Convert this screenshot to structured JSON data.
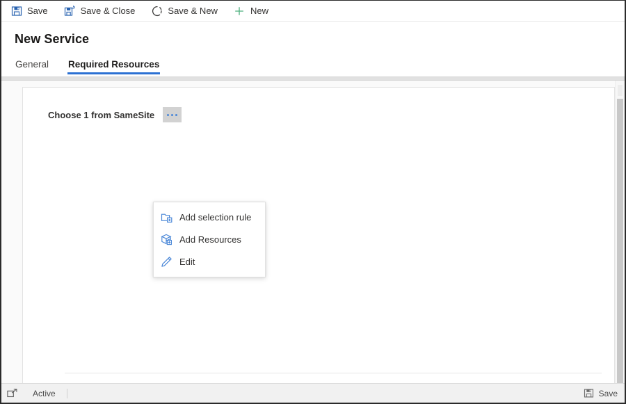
{
  "window": {
    "title": "New Service"
  },
  "commandbar": {
    "buttons": [
      {
        "label": "Save",
        "icon": "save-floppy-icon",
        "icon_color": "#2a63b0"
      },
      {
        "label": "Save & Close",
        "icon": "save-close-floppy-icon",
        "icon_color": "#2a63b0"
      },
      {
        "label": "Save & New",
        "icon": "save-new-icon",
        "icon_color": "#3b3a39"
      },
      {
        "label": "New",
        "icon": "plus-icon",
        "icon_color": "#4caf7d"
      }
    ]
  },
  "tabs": [
    {
      "label": "General",
      "active": false
    },
    {
      "label": "Required Resources",
      "active": true
    }
  ],
  "form": {
    "field_label": "Choose 1 from SameSite",
    "ellipsis_button_name": "more-options"
  },
  "context_menu": {
    "items": [
      {
        "label": "Add selection rule",
        "icon": "folder-add-icon"
      },
      {
        "label": "Add Resources",
        "icon": "box-add-icon"
      },
      {
        "label": "Edit",
        "icon": "pencil-icon"
      }
    ]
  },
  "statusbar": {
    "expand_icon": "expand-popout-icon",
    "state": "Active",
    "save_label": "Save",
    "save_icon": "save-floppy-icon"
  },
  "colors": {
    "accent_blue": "#2b70d3",
    "icon_blue": "#2a63b0",
    "menu_icon_blue": "#4a87d8",
    "new_green": "#4caf7d",
    "ellipsis_bg": "#d2d2d2"
  }
}
